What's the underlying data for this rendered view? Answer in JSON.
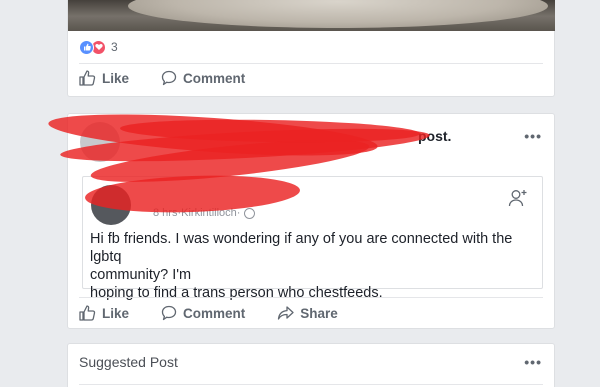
{
  "post1": {
    "reaction_count": "3",
    "actions": {
      "like": "Like",
      "comment": "Comment"
    }
  },
  "post2": {
    "header_suffix": "post.",
    "more": "•••",
    "shared_post": {
      "meta_time": "8 hrs",
      "meta_sep": " · ",
      "meta_location": "Kirkintilloch",
      "meta_sep2": " · ",
      "body_lines": [
        "Hi fb friends. I was wondering if any of you are connected with the lgbtq",
        "community? I'm",
        "hoping to find a trans person who chestfeeds."
      ]
    },
    "actions": {
      "like": "Like",
      "comment": "Comment",
      "share": "Share"
    }
  },
  "post3": {
    "title": "Suggested Post",
    "more": "•••"
  },
  "colors": {
    "background": "#e9ebee",
    "card": "#ffffff",
    "action_text": "#606770",
    "like_reaction": "#5890ff",
    "love_reaction": "#f25268",
    "redaction": "#ea2222"
  }
}
